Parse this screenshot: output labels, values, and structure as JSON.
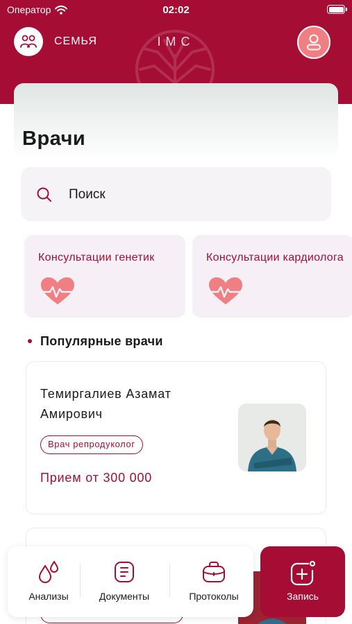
{
  "status_bar": {
    "carrier": "Оператор",
    "time": "02:02"
  },
  "header": {
    "family_label": "СЕМЬЯ",
    "brand": "IMC"
  },
  "page": {
    "title": "Врачи"
  },
  "search": {
    "placeholder": "Поиск"
  },
  "categories": [
    {
      "label": "Консультации генетик",
      "icon": "heart-pulse-icon"
    },
    {
      "label": "Консультации кардиолога",
      "icon": "heart-pulse-icon"
    }
  ],
  "popular": {
    "title": "Популярные врачи",
    "doctors": [
      {
        "name": "Темиргалиев Азамат Амирович",
        "specialty": "Врач репродуколог",
        "price": "Прием от 300 000"
      }
    ]
  },
  "bottom_nav": {
    "items": [
      {
        "label": "Анализы",
        "icon": "drops-icon"
      },
      {
        "label": "Документы",
        "icon": "document-icon"
      },
      {
        "label": "Протоколы",
        "icon": "briefcase-icon"
      }
    ],
    "primary": {
      "label": "Запись",
      "icon": "add-appointment-icon"
    }
  },
  "colors": {
    "brand": "#a50d35",
    "accent": "#f07f84",
    "card": "#f6f0f6"
  }
}
